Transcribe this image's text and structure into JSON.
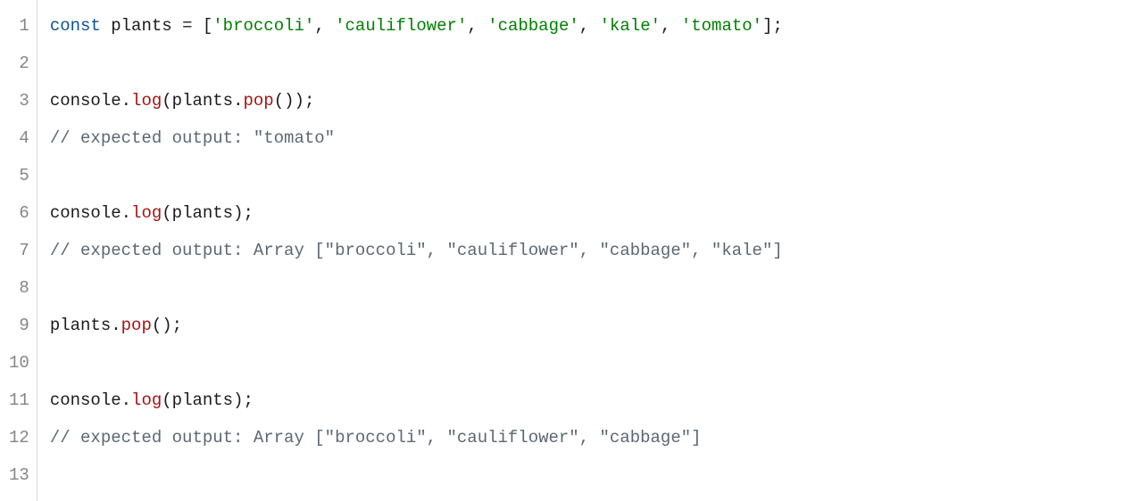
{
  "editor": {
    "gutter": [
      "1",
      "2",
      "3",
      "4",
      "5",
      "6",
      "7",
      "8",
      "9",
      "10",
      "11",
      "12",
      "13"
    ],
    "lines": {
      "l1": {
        "const_kw": "const",
        "sp1": " ",
        "name": "plants",
        "sp2": " ",
        "eq": "=",
        "sp3": " ",
        "lb": "[",
        "s1": "'broccoli'",
        "c1": ", ",
        "s2": "'cauliflower'",
        "c2": ", ",
        "s3": "'cabbage'",
        "c3": ", ",
        "s4": "'kale'",
        "c4": ", ",
        "s5": "'tomato'",
        "rb": "]",
        "semi": ";"
      },
      "l3": {
        "obj": "console",
        "dot1": ".",
        "log": "log",
        "lp": "(",
        "arg": "plants",
        "dot2": ".",
        "pop": "pop",
        "argp": "()",
        "rp": ")",
        "semi": ";"
      },
      "l4": {
        "comment": "// expected output: \"tomato\""
      },
      "l6": {
        "obj": "console",
        "dot1": ".",
        "log": "log",
        "lp": "(",
        "arg": "plants",
        "rp": ")",
        "semi": ";"
      },
      "l7": {
        "comment": "// expected output: Array [\"broccoli\", \"cauliflower\", \"cabbage\", \"kale\"]"
      },
      "l9": {
        "obj": "plants",
        "dot": ".",
        "pop": "pop",
        "call": "()",
        "semi": ";"
      },
      "l11": {
        "obj": "console",
        "dot1": ".",
        "log": "log",
        "lp": "(",
        "arg": "plants",
        "rp": ")",
        "semi": ";"
      },
      "l12": {
        "comment": "// expected output: Array [\"broccoli\", \"cauliflower\", \"cabbage\"]"
      }
    }
  }
}
